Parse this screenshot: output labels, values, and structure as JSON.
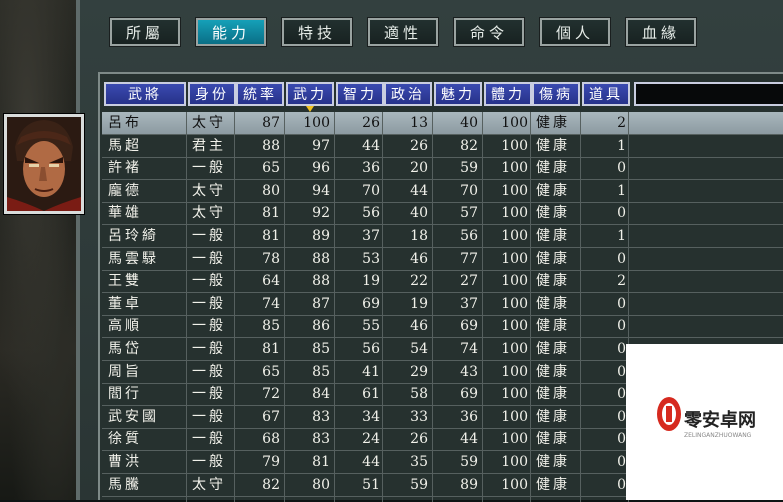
{
  "tabs": [
    "所屬",
    "能力",
    "特技",
    "適性",
    "命令",
    "個人",
    "血緣"
  ],
  "active_tab": 1,
  "columns": [
    "武將",
    "身份",
    "統率",
    "武力",
    "智力",
    "政治",
    "魅力",
    "體力",
    "傷病",
    "道具"
  ],
  "sorted_column": 3,
  "selected_row": 0,
  "rows": [
    [
      "呂布",
      "太守",
      "87",
      "100",
      "26",
      "13",
      "40",
      "100",
      "健康",
      "2"
    ],
    [
      "馬超",
      "君主",
      "88",
      "97",
      "44",
      "26",
      "82",
      "100",
      "健康",
      "1"
    ],
    [
      "許褚",
      "一般",
      "65",
      "96",
      "36",
      "20",
      "59",
      "100",
      "健康",
      "0"
    ],
    [
      "龐德",
      "太守",
      "80",
      "94",
      "70",
      "44",
      "70",
      "100",
      "健康",
      "1"
    ],
    [
      "華雄",
      "太守",
      "81",
      "92",
      "56",
      "40",
      "57",
      "100",
      "健康",
      "0"
    ],
    [
      "呂玲綺",
      "一般",
      "81",
      "89",
      "37",
      "18",
      "56",
      "100",
      "健康",
      "1"
    ],
    [
      "馬雲騄",
      "一般",
      "78",
      "88",
      "53",
      "46",
      "77",
      "100",
      "健康",
      "0"
    ],
    [
      "王雙",
      "一般",
      "64",
      "88",
      "19",
      "22",
      "27",
      "100",
      "健康",
      "2"
    ],
    [
      "董卓",
      "一般",
      "74",
      "87",
      "69",
      "19",
      "37",
      "100",
      "健康",
      "0"
    ],
    [
      "高順",
      "一般",
      "85",
      "86",
      "55",
      "46",
      "69",
      "100",
      "健康",
      "0"
    ],
    [
      "馬岱",
      "一般",
      "81",
      "85",
      "56",
      "54",
      "74",
      "100",
      "健康",
      "0"
    ],
    [
      "周旨",
      "一般",
      "65",
      "85",
      "41",
      "29",
      "43",
      "100",
      "健康",
      "0"
    ],
    [
      "閻行",
      "一般",
      "72",
      "84",
      "61",
      "58",
      "69",
      "100",
      "健康",
      "0"
    ],
    [
      "武安國",
      "一般",
      "67",
      "83",
      "34",
      "33",
      "36",
      "100",
      "健康",
      "0"
    ],
    [
      "徐質",
      "一般",
      "68",
      "83",
      "24",
      "26",
      "44",
      "100",
      "健康",
      "0"
    ],
    [
      "曹洪",
      "一般",
      "79",
      "81",
      "44",
      "35",
      "59",
      "100",
      "健康",
      "0"
    ],
    [
      "馬騰",
      "太守",
      "82",
      "80",
      "51",
      "59",
      "89",
      "100",
      "健康",
      "0"
    ]
  ],
  "watermark": {
    "brand": "零安卓网",
    "sub": "ZELINGANZHUOWANG"
  },
  "colors": {
    "header": "#2e3a9c",
    "active_tab": "#0f8ea6",
    "sort_marker": "#f0c020"
  }
}
